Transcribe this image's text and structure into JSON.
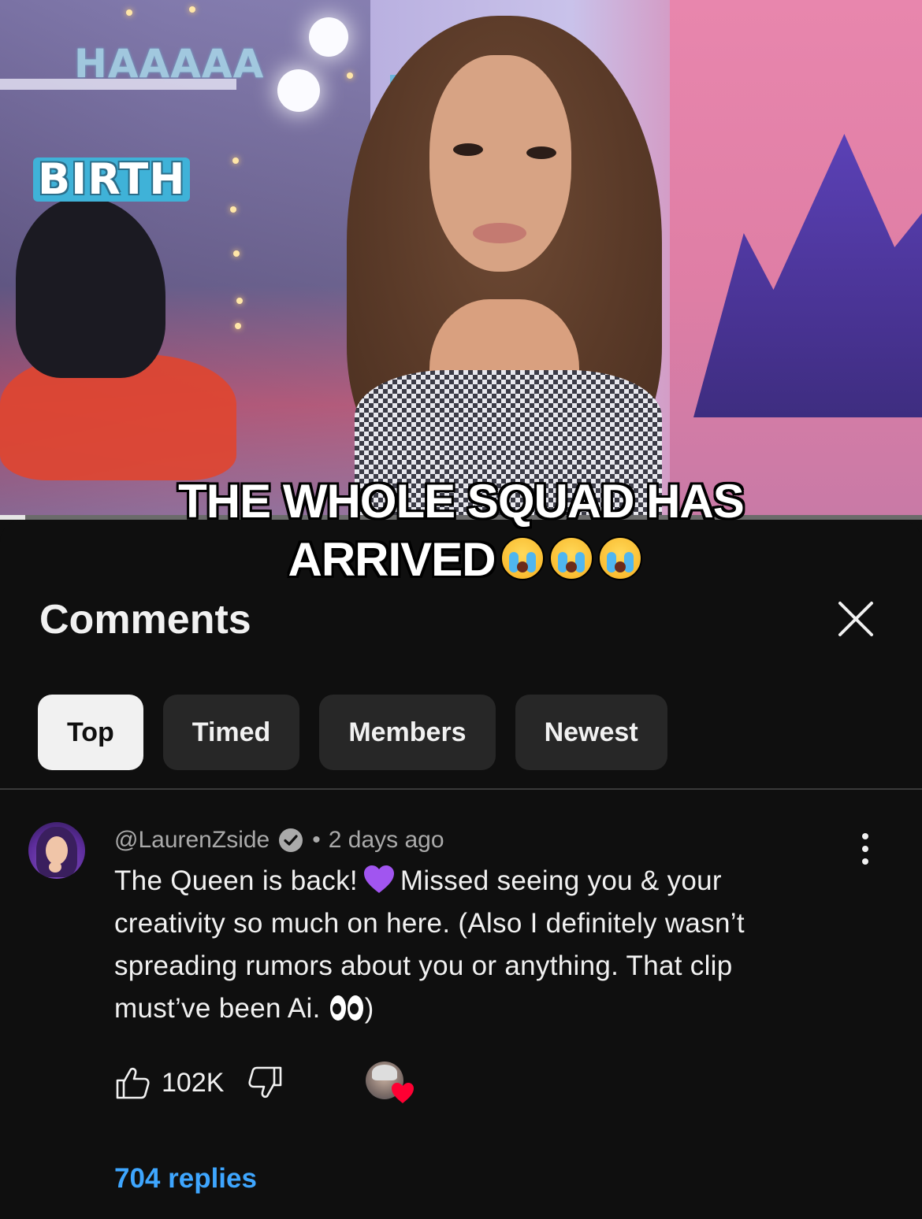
{
  "video": {
    "overlay_tag_1": "HAAAAA",
    "overlay_tag_2": "BIRTH",
    "caption_line1": "THE WHOLE SQUAD HAS",
    "caption_line2": "ARRIVED",
    "caption_emoji": "loudly-crying-face x3",
    "progress_fraction": 0.027
  },
  "comments_panel": {
    "title": "Comments",
    "close_icon": "close-icon",
    "chips": [
      {
        "label": "Top",
        "active": true
      },
      {
        "label": "Timed",
        "active": false
      },
      {
        "label": "Members",
        "active": false
      },
      {
        "label": "Newest",
        "active": false
      }
    ]
  },
  "comment": {
    "author": "@LaurenZside",
    "verified_icon": "verified-check-icon",
    "separator": "•",
    "time": "2 days ago",
    "text_part1": "The Queen is back!",
    "text_emoji1": "purple-heart",
    "text_part2": "Missed seeing you & your creativity so much on here. (Also I definitely wasn’t spreading rumors about you or anything. That clip must’ve been Ai.",
    "text_emoji2": "eyes",
    "text_part3": ")",
    "like_count": "102K",
    "like_icon": "thumbs-up-icon",
    "dislike_icon": "thumbs-down-icon",
    "creator_heart_icon": "creator-heart-icon",
    "more_icon": "more-vertical-icon",
    "replies": "704 replies"
  },
  "colors": {
    "background": "#0f0f0f",
    "chip_bg": "#272727",
    "chip_active_bg": "#f1f1f1",
    "link_blue": "#3ea6ff",
    "secondary_text": "#aaaaaa",
    "heart_red": "#ff0033"
  }
}
